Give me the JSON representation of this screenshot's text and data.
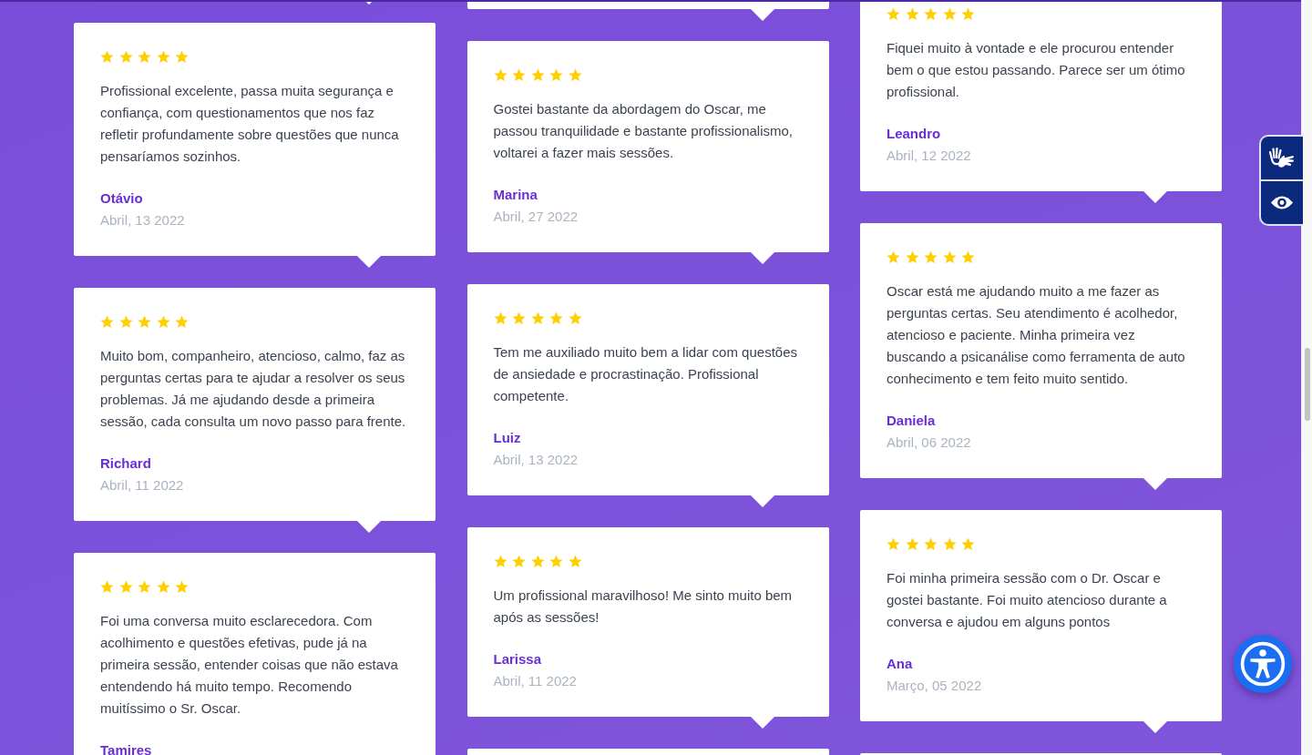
{
  "columns": [
    {
      "reviews": [
        {
          "stars": 5,
          "text": "Profissional excelente, passa muita segurança e confiança, com questionamentos que nos faz refletir profundamente sobre questões que nunca pensaríamos sozinhos.",
          "name": "Otávio",
          "date": "Abril, 13 2022"
        },
        {
          "stars": 5,
          "text": "Muito bom, companheiro, atencioso, calmo, faz as perguntas certas para te ajudar a resolver os seus problemas. Já me ajudando desde a primeira sessão, cada consulta um novo passo para frente.",
          "name": "Richard",
          "date": "Abril, 11 2022"
        },
        {
          "stars": 5,
          "text": "Foi uma conversa muito esclarecedora. Com acolhimento e questões efetivas, pude já na primeira sessão, entender coisas que não estava entendendo há muito tempo. Recomendo muitíssimo o Sr. Oscar.",
          "name": "Tamires"
        }
      ]
    },
    {
      "reviews": [
        {
          "stars": 5,
          "text": "Gostei bastante da abordagem do Oscar, me passou tranquilidade e bastante profissionalismo, voltarei a fazer mais sessões.",
          "name": "Marina",
          "date": "Abril, 27 2022"
        },
        {
          "stars": 5,
          "text": "Tem me auxiliado muito bem a lidar com questões de ansiedade e procrastinação. Profissional competente.",
          "name": "Luiz",
          "date": "Abril, 13 2022"
        },
        {
          "stars": 5,
          "text": "Um profissional maravilhoso! Me sinto muito bem após as sessões!",
          "name": "Larissa",
          "date": "Abril, 11 2022"
        }
      ]
    },
    {
      "reviews": [
        {
          "stars": 5,
          "text": "Fiquei muito à vontade e ele procurou entender bem o que estou passando. Parece ser um ótimo profissional.",
          "name": "Leandro",
          "date": "Abril, 12 2022"
        },
        {
          "stars": 5,
          "text": "Oscar está me ajudando muito a me fazer as perguntas certas. Seu atendimento é acolhedor, atencioso e paciente. Minha primeira vez buscando a psicanálise como ferramenta de auto conhecimento e tem feito muito sentido.",
          "name": "Daniela",
          "date": "Abril, 06 2022"
        },
        {
          "stars": 5,
          "text": "Foi minha primeira sessão com o Dr. Oscar e gostei bastante. Foi muito atencioso durante a conversa e ajudou em alguns pontos",
          "name": "Ana",
          "date": "Março, 05 2022"
        }
      ]
    }
  ]
}
